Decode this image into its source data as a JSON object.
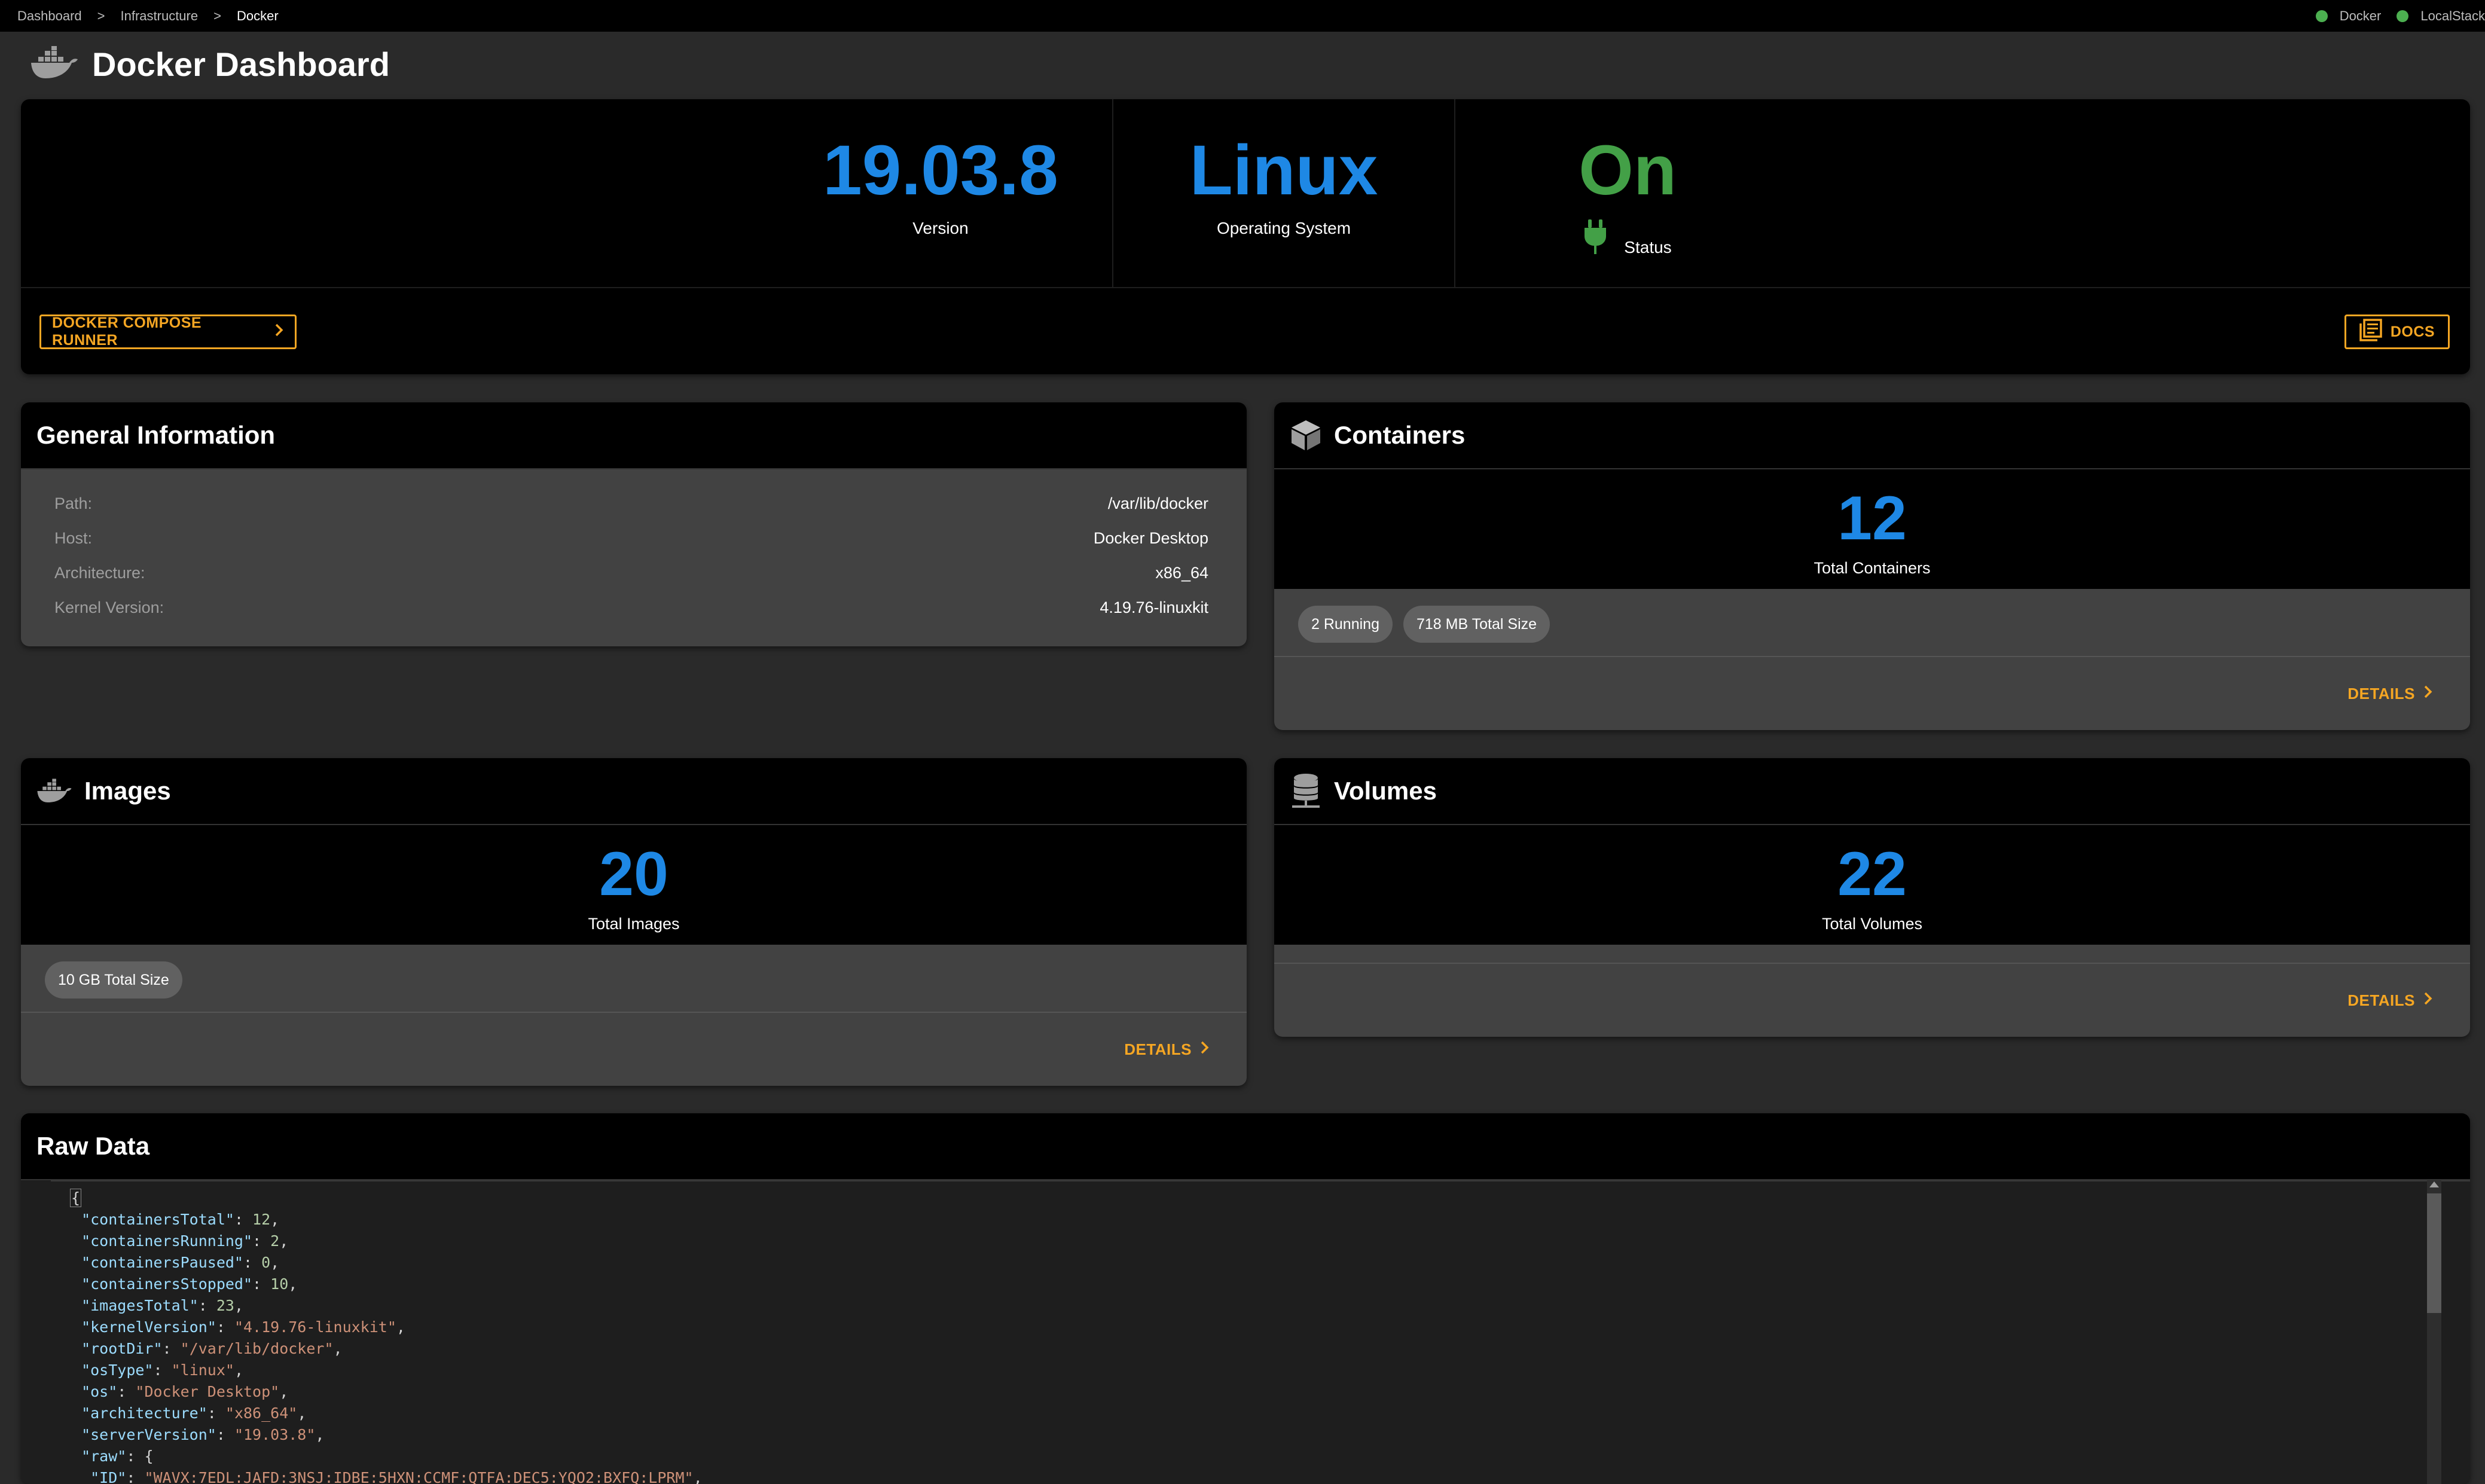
{
  "breadcrumb": {
    "items": [
      "Dashboard",
      "Infrastructure",
      "Docker"
    ],
    "separator": ">"
  },
  "services": [
    {
      "label": "Docker",
      "status_color": "#4caf50"
    },
    {
      "label": "LocalStack",
      "status_color": "#4caf50"
    }
  ],
  "page": {
    "title": "Docker Dashboard",
    "icon": "docker-whale-icon"
  },
  "summary": {
    "version": {
      "value": "19.03.8",
      "label": "Version"
    },
    "os": {
      "value": "Linux",
      "label": "Operating System"
    },
    "status": {
      "value": "On",
      "label": "Status",
      "icon": "plug-icon"
    },
    "compose_button": "DOCKER COMPOSE RUNNER",
    "docs_button": "DOCS"
  },
  "general": {
    "title": "General Information",
    "rows": [
      {
        "key": "Path:",
        "value": "/var/lib/docker"
      },
      {
        "key": "Host:",
        "value": "Docker Desktop"
      },
      {
        "key": "Architecture:",
        "value": "x86_64"
      },
      {
        "key": "Kernel Version:",
        "value": "4.19.76-linuxkit"
      }
    ]
  },
  "containers": {
    "title": "Containers",
    "icon": "cube-icon",
    "count": "12",
    "caption": "Total Containers",
    "chips": [
      "2 Running",
      "718 MB Total Size"
    ],
    "details": "DETAILS"
  },
  "images": {
    "title": "Images",
    "icon": "docker-whale-icon",
    "count": "20",
    "caption": "Total Images",
    "chips": [
      "10 GB Total Size"
    ],
    "details": "DETAILS"
  },
  "volumes": {
    "title": "Volumes",
    "icon": "database-icon",
    "count": "22",
    "caption": "Total Volumes",
    "details": "DETAILS"
  },
  "raw": {
    "title": "Raw Data",
    "open_brace": "{",
    "lines": [
      {
        "key": "\"containersTotal\"",
        "value": "12",
        "type": "number"
      },
      {
        "key": "\"containersRunning\"",
        "value": "2",
        "type": "number"
      },
      {
        "key": "\"containersPaused\"",
        "value": "0",
        "type": "number"
      },
      {
        "key": "\"containersStopped\"",
        "value": "10",
        "type": "number"
      },
      {
        "key": "\"imagesTotal\"",
        "value": "23",
        "type": "number"
      },
      {
        "key": "\"kernelVersion\"",
        "value": "\"4.19.76-linuxkit\"",
        "type": "string"
      },
      {
        "key": "\"rootDir\"",
        "value": "\"/var/lib/docker\"",
        "type": "string"
      },
      {
        "key": "\"osType\"",
        "value": "\"linux\"",
        "type": "string"
      },
      {
        "key": "\"os\"",
        "value": "\"Docker Desktop\"",
        "type": "string"
      },
      {
        "key": "\"architecture\"",
        "value": "\"x86_64\"",
        "type": "string"
      },
      {
        "key": "\"serverVersion\"",
        "value": "\"19.03.8\"",
        "type": "string"
      },
      {
        "key": "\"raw\"",
        "value": "{",
        "type": "open"
      },
      {
        "key": "\"ID\"",
        "value": "\"WAVX:7EDL:JAFD:3NSJ:IDBE:5HXN:CCMF:QTFA:DEC5:YQO2:BXFQ:LPRM\"",
        "type": "string",
        "indent": 2
      }
    ]
  },
  "colors": {
    "accent_blue": "#1e88e5",
    "accent_green": "#43a047",
    "accent_orange": "#f5a623",
    "status_dot": "#4caf50"
  }
}
